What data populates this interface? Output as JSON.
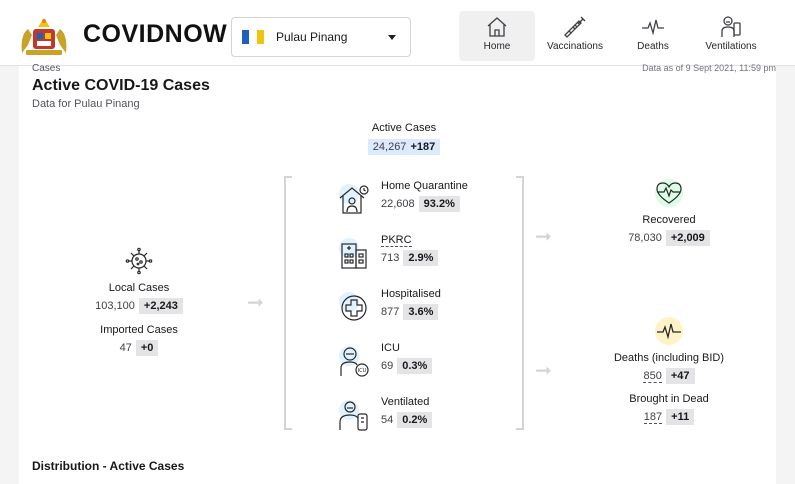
{
  "header": {
    "brand": "COVIDNOW",
    "state_select": {
      "value": "Pulau Pinang"
    },
    "nav": [
      {
        "label": "Home",
        "icon": "home-icon",
        "active": true
      },
      {
        "label": "Vaccinations",
        "icon": "syringe-icon",
        "active": false
      },
      {
        "label": "Deaths",
        "icon": "pulse-icon",
        "active": false
      },
      {
        "label": "Ventilations",
        "icon": "ventilator-icon",
        "active": false
      }
    ]
  },
  "page": {
    "breadcrumb": "Cases",
    "as_of": "Data as of 9 Sept 2021, 11:59 pm",
    "title": "Active COVID-19 Cases",
    "subtitle": "Data for Pulau Pinang",
    "section_footer": "Distribution - Active Cases"
  },
  "active_cases": {
    "label": "Active Cases",
    "value": "24,267",
    "delta": "+187"
  },
  "local_cases": {
    "label": "Local Cases",
    "value": "103,100",
    "delta": "+2,243"
  },
  "imported_cases": {
    "label": "Imported Cases",
    "value": "47",
    "delta": "+0"
  },
  "buckets": [
    {
      "label": "Home Quarantine",
      "value": "22,608",
      "pct": "93.2%",
      "icon": "home-quarantine-icon"
    },
    {
      "label": "PKRC",
      "value": "713",
      "pct": "2.9%",
      "icon": "building-icon"
    },
    {
      "label": "Hospitalised",
      "value": "877",
      "pct": "3.6%",
      "icon": "hospital-cross-icon"
    },
    {
      "label": "ICU",
      "value": "69",
      "pct": "0.3%",
      "icon": "icu-icon"
    },
    {
      "label": "Ventilated",
      "value": "54",
      "pct": "0.2%",
      "icon": "ventilated-icon"
    }
  ],
  "recovered": {
    "label": "Recovered",
    "value": "78,030",
    "delta": "+2,009"
  },
  "deaths": {
    "label": "Deaths (including BID)",
    "value": "850",
    "delta": "+47"
  },
  "brought_in_dead": {
    "label": "Brought in Dead",
    "value": "187",
    "delta": "+11"
  },
  "colors": {
    "accent_blue": "#dbeafe",
    "recovered_green": "#dcfce7",
    "deaths_yellow": "#fef3c7"
  }
}
